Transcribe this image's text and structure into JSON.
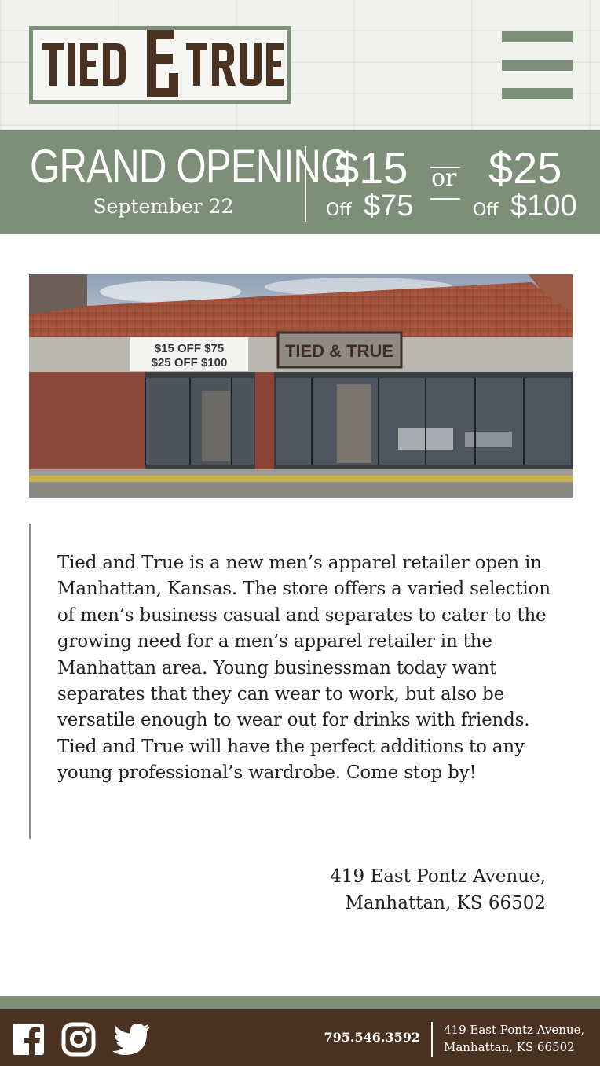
{
  "header": {
    "logo": {
      "text": "TIED & TRUE"
    },
    "menu_icon": "hamburger-menu-icon"
  },
  "banner": {
    "title": "GRAND OPENING",
    "date": "September 22",
    "offer_1": {
      "amount": "$15",
      "off_label": "Off",
      "threshold": "$75"
    },
    "or_label": "or",
    "offer_2": {
      "amount": "$25",
      "off_label": "Off",
      "threshold": "$100"
    }
  },
  "photo": {
    "sign_line_1": "$15 OFF $75",
    "sign_line_2": "$25 OFF $100",
    "store_sign": "TIED & TRUE"
  },
  "description": "Tied and True is a new men’s apparel retailer open in Manhattan, Kansas. The store offers a varied selection of men’s business casual and separates to cater to the growing need for a men’s apparel retailer in the Manhattan area. Young businessman today want separates that they can wear to work, but also be versatile enough to wear out for drinks with friends. Tied and True will have the perfect additions to any young professional’s wardrobe. Come stop by!",
  "address": {
    "line_1": "419 East Pontz Avenue,",
    "line_2": "Manhattan, KS 66502"
  },
  "footer": {
    "social_icons": [
      "facebook-icon",
      "instagram-icon",
      "twitter-icon"
    ],
    "phone": "795.546.3592",
    "address_line_1": "419 East Pontz Avenue,",
    "address_line_2": "Manhattan, KS 66502"
  },
  "colors": {
    "sage": "#7d8f79",
    "brown": "#4a3222",
    "logo_text": "#4a3222",
    "background": "#ffffff"
  }
}
